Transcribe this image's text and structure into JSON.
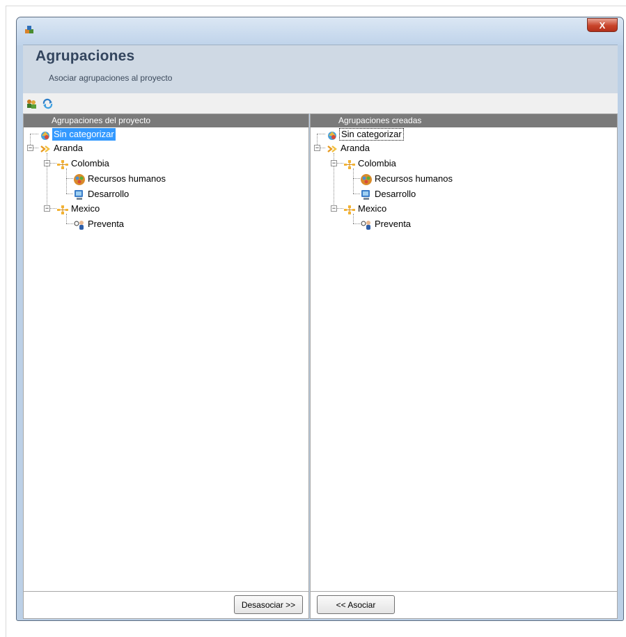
{
  "window": {
    "close_glyph": "X"
  },
  "header": {
    "title": "Agrupaciones",
    "subtitle": "Asociar agrupaciones al proyecto"
  },
  "toolbar": {
    "icons": [
      "associate-groups-icon",
      "refresh-icon"
    ]
  },
  "left_pane": {
    "header": "Agrupaciones del proyecto",
    "button_label": "Desasociar >>",
    "tree": {
      "sin_categorizar": "Sin categorizar",
      "aranda": "Aranda",
      "colombia": "Colombia",
      "recursos_humanos": "Recursos humanos",
      "desarrollo": "Desarrollo",
      "mexico": "Mexico",
      "preventa": "Preventa"
    }
  },
  "right_pane": {
    "header": "Agrupaciones creadas",
    "button_label": "<< Asociar",
    "tree": {
      "sin_categorizar": "Sin categorizar",
      "aranda": "Aranda",
      "colombia": "Colombia",
      "recursos_humanos": "Recursos humanos",
      "desarrollo": "Desarrollo",
      "mexico": "Mexico",
      "preventa": "Preventa"
    }
  },
  "colors": {
    "selection": "#3399ff",
    "pane_header": "#7a7a7a",
    "title_text": "#33455e"
  }
}
